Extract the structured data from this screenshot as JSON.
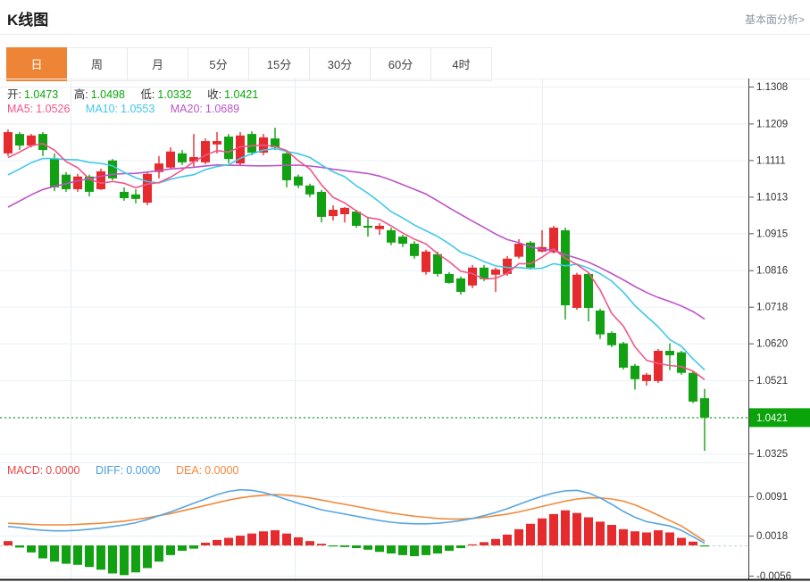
{
  "header": {
    "title": "K线图",
    "link_label": "基本面分析>"
  },
  "tabs": {
    "items": [
      "日",
      "周",
      "月",
      "5分",
      "15分",
      "30分",
      "60分",
      "4时"
    ],
    "active_index": 0
  },
  "legend": {
    "ohlc": [
      {
        "label": "开:",
        "value": "1.0473"
      },
      {
        "label": "高:",
        "value": "1.0498"
      },
      {
        "label": "低:",
        "value": "1.0332"
      },
      {
        "label": "收:",
        "value": "1.0421"
      }
    ],
    "ma": [
      {
        "label": "MA5:",
        "value": "1.0526"
      },
      {
        "label": "MA10:",
        "value": "1.0553"
      },
      {
        "label": "MA20:",
        "value": "1.0689"
      }
    ],
    "macd": [
      {
        "label": "MACD:",
        "value": "0.0000"
      },
      {
        "label": "DIFF:",
        "value": "0.0000"
      },
      {
        "label": "DEA:",
        "value": "0.0000"
      }
    ]
  },
  "colors": {
    "up_red": "#e62b2f",
    "down_green": "#12a112",
    "value_green": "#0ca70c",
    "ma5_pink": "#f0558a",
    "ma10_cyan": "#40c8e8",
    "ma20_purple": "#bd54c6",
    "diff_blue": "#58a6e0",
    "dea_orange": "#f08a3c",
    "tab_active_orange": "#ee8435",
    "current_price_green": "#0aa30a",
    "grid": "#e4edf4"
  },
  "chart_data": {
    "type": "candlestick+macd",
    "title": "K线图 (日)",
    "legend_position": "top-left",
    "grid": true,
    "price_axis": {
      "side": "right",
      "ylim": [
        1.0325,
        1.1308
      ],
      "ticks": [
        "1.1308",
        "1.1209",
        "1.1111",
        "1.1013",
        "1.0915",
        "1.0816",
        "1.0718",
        "1.0620",
        "1.0521",
        "1.0421",
        "1.0325"
      ],
      "current_price": "1.0421"
    },
    "macd_axis": {
      "side": "right",
      "ylim": [
        -0.0061,
        0.0145
      ],
      "ticks": [
        "0.0091",
        "0.0018",
        "-0.0056"
      ]
    },
    "candles_ohlc": [
      [
        1.1129,
        1.1193,
        1.1122,
        1.1186
      ],
      [
        1.1181,
        1.1186,
        1.1138,
        1.115
      ],
      [
        1.115,
        1.1181,
        1.1145,
        1.1177
      ],
      [
        1.1181,
        1.1186,
        1.1122,
        1.1138
      ],
      [
        1.1114,
        1.1129,
        1.1028,
        1.1038
      ],
      [
        1.1072,
        1.1079,
        1.1026,
        1.1033
      ],
      [
        1.1033,
        1.1074,
        1.1026,
        1.1067
      ],
      [
        1.1067,
        1.1072,
        1.1014,
        1.1026
      ],
      [
        1.1033,
        1.1088,
        1.1031,
        1.1081
      ],
      [
        1.111,
        1.1114,
        1.1057,
        1.1062
      ],
      [
        1.1026,
        1.1038,
        1.1002,
        1.1009
      ],
      [
        1.1019,
        1.1033,
        1.0995,
        1.1007
      ],
      [
        1.0997,
        1.1079,
        1.099,
        1.1074
      ],
      [
        1.1079,
        1.1122,
        1.1062,
        1.1102
      ],
      [
        1.1091,
        1.1145,
        1.1086,
        1.1134
      ],
      [
        1.1129,
        1.1138,
        1.1098,
        1.1105
      ],
      [
        1.1107,
        1.1181,
        1.1093,
        1.1119
      ],
      [
        1.1105,
        1.1169,
        1.11,
        1.1162
      ],
      [
        1.1153,
        1.1186,
        1.1129,
        1.1162
      ],
      [
        1.1174,
        1.1181,
        1.1103,
        1.1114
      ],
      [
        1.1102,
        1.1186,
        1.1095,
        1.1177
      ],
      [
        1.1181,
        1.1188,
        1.1124,
        1.1131
      ],
      [
        1.1131,
        1.1181,
        1.1124,
        1.1172
      ],
      [
        1.1169,
        1.1198,
        1.1138,
        1.1145
      ],
      [
        1.1129,
        1.1136,
        1.1038,
        1.1057
      ],
      [
        1.1067,
        1.1072,
        1.1036,
        1.1043
      ],
      [
        1.1043,
        1.1048,
        1.1012,
        1.1019
      ],
      [
        1.1026,
        1.1031,
        1.0944,
        1.0959
      ],
      [
        1.0961,
        1.099,
        1.0949,
        1.0978
      ],
      [
        1.0966,
        1.0985,
        1.0944,
        1.0983
      ],
      [
        1.0973,
        1.0978,
        1.093,
        1.0935
      ],
      [
        1.0935,
        1.0959,
        1.0906,
        1.093
      ],
      [
        1.0926,
        1.0942,
        1.0911,
        1.0935
      ],
      [
        1.0923,
        1.093,
        1.0883,
        1.089
      ],
      [
        1.0906,
        1.0911,
        1.0878,
        1.0887
      ],
      [
        1.0887,
        1.0894,
        1.0847,
        1.0854
      ],
      [
        1.0811,
        1.0871,
        1.0804,
        1.0866
      ],
      [
        1.0859,
        1.0866,
        1.0799,
        1.0806
      ],
      [
        1.0806,
        1.0811,
        1.078,
        1.0782
      ],
      [
        1.0794,
        1.0799,
        1.0751,
        1.0758
      ],
      [
        1.0775,
        1.083,
        1.0768,
        1.0823
      ],
      [
        1.0823,
        1.083,
        1.0787,
        1.0792
      ],
      [
        1.0804,
        1.0823,
        1.0758,
        1.0818
      ],
      [
        1.0806,
        1.0854,
        1.0801,
        1.0847
      ],
      [
        1.0852,
        1.0899,
        1.0847,
        1.0887
      ],
      [
        1.089,
        1.0894,
        1.0818,
        1.0823
      ],
      [
        1.0866,
        1.0923,
        1.0864,
        1.0878
      ],
      [
        1.0864,
        1.0935,
        1.0861,
        1.093
      ],
      [
        1.0923,
        1.093,
        1.0684,
        1.0722
      ],
      [
        1.0715,
        1.0809,
        1.071,
        1.0804
      ],
      [
        1.0806,
        1.0811,
        1.0679,
        1.0715
      ],
      [
        1.0708,
        1.0713,
        1.0632,
        1.0644
      ],
      [
        1.0648,
        1.0652,
        1.061,
        1.0615
      ],
      [
        1.062,
        1.0624,
        1.055,
        1.0555
      ],
      [
        1.056,
        1.0565,
        1.0496,
        1.0524
      ],
      [
        1.0519,
        1.0541,
        1.0507,
        1.0536
      ],
      [
        1.0519,
        1.0605,
        1.0514,
        1.06
      ],
      [
        1.06,
        1.062,
        1.0548,
        1.0588
      ],
      [
        1.0596,
        1.06,
        1.0536,
        1.0541
      ],
      [
        1.0541,
        1.0545,
        1.046,
        1.0464
      ],
      [
        1.0473,
        1.0498,
        1.0332,
        1.0421
      ]
    ],
    "macd": {
      "bars": [
        0.0008,
        -0.0004,
        -0.0013,
        -0.0024,
        -0.003,
        -0.0034,
        -0.0036,
        -0.004,
        -0.0045,
        -0.0052,
        -0.0055,
        -0.005,
        -0.0042,
        -0.003,
        -0.0018,
        -0.001,
        -0.0006,
        0.0005,
        0.001,
        0.0014,
        0.0018,
        0.0022,
        0.0026,
        0.0028,
        0.0022,
        0.0015,
        0.0008,
        0.0003,
        -0.0002,
        -0.0003,
        -0.0005,
        -0.0008,
        -0.0012,
        -0.0015,
        -0.0018,
        -0.002,
        -0.0018,
        -0.0015,
        -0.001,
        -0.0005,
        0.0002,
        0.0006,
        0.0012,
        0.002,
        0.003,
        0.004,
        0.005,
        0.0058,
        0.0065,
        0.006,
        0.0052,
        0.0044,
        0.0038,
        0.003,
        0.0026,
        0.0024,
        0.0028,
        0.0024,
        0.0014,
        0.0007,
        0.0
      ],
      "diff": [
        0.0035,
        0.0033,
        0.003,
        0.0028,
        0.0027,
        0.0027,
        0.0028,
        0.003,
        0.0032,
        0.0035,
        0.0038,
        0.0042,
        0.0048,
        0.0055,
        0.0062,
        0.007,
        0.0078,
        0.0086,
        0.0094,
        0.01,
        0.0103,
        0.0102,
        0.0098,
        0.0092,
        0.0085,
        0.0078,
        0.0072,
        0.0066,
        0.0062,
        0.0058,
        0.0054,
        0.005,
        0.0046,
        0.0043,
        0.0041,
        0.004,
        0.004,
        0.0041,
        0.0043,
        0.0046,
        0.005,
        0.0055,
        0.0061,
        0.0068,
        0.0076,
        0.0084,
        0.0091,
        0.0097,
        0.0101,
        0.0102,
        0.0097,
        0.0088,
        0.0076,
        0.0063,
        0.0052,
        0.0044,
        0.004,
        0.0036,
        0.0028,
        0.0016,
        0.0004
      ],
      "dea": [
        0.0041,
        0.004,
        0.0039,
        0.0038,
        0.0038,
        0.0038,
        0.0039,
        0.004,
        0.0041,
        0.0043,
        0.0045,
        0.0048,
        0.0051,
        0.0055,
        0.0059,
        0.0064,
        0.0069,
        0.0074,
        0.0079,
        0.0084,
        0.0088,
        0.0091,
        0.0093,
        0.0094,
        0.0093,
        0.0091,
        0.0088,
        0.0084,
        0.008,
        0.0076,
        0.0072,
        0.0068,
        0.0064,
        0.006,
        0.0057,
        0.0054,
        0.0052,
        0.005,
        0.0049,
        0.0049,
        0.005,
        0.0052,
        0.0055,
        0.0058,
        0.0062,
        0.0067,
        0.0072,
        0.0077,
        0.0082,
        0.0086,
        0.0088,
        0.0088,
        0.0086,
        0.0082,
        0.0075,
        0.0066,
        0.0056,
        0.0046,
        0.0036,
        0.0022,
        0.0008
      ]
    }
  }
}
